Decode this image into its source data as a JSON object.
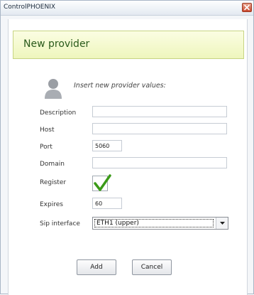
{
  "window": {
    "title": "ControlPHOENIX"
  },
  "header": {
    "title": "New provider"
  },
  "intro": {
    "text": "Insert new provider values:",
    "icon": "user-icon"
  },
  "form": {
    "description": {
      "label": "Description",
      "value": ""
    },
    "host": {
      "label": "Host",
      "value": ""
    },
    "port": {
      "label": "Port",
      "value": "5060"
    },
    "domain": {
      "label": "Domain",
      "value": ""
    },
    "register": {
      "label": "Register",
      "checked": true
    },
    "expires": {
      "label": "Expires",
      "value": "60"
    },
    "sip_interface": {
      "label": "Sip interface",
      "selected": "ETH1 (upper)"
    }
  },
  "buttons": {
    "add": "Add",
    "cancel": "Cancel"
  },
  "colors": {
    "banner_text": "#2a5a1a",
    "check": "#3b9a18",
    "close": "#c9462c"
  }
}
